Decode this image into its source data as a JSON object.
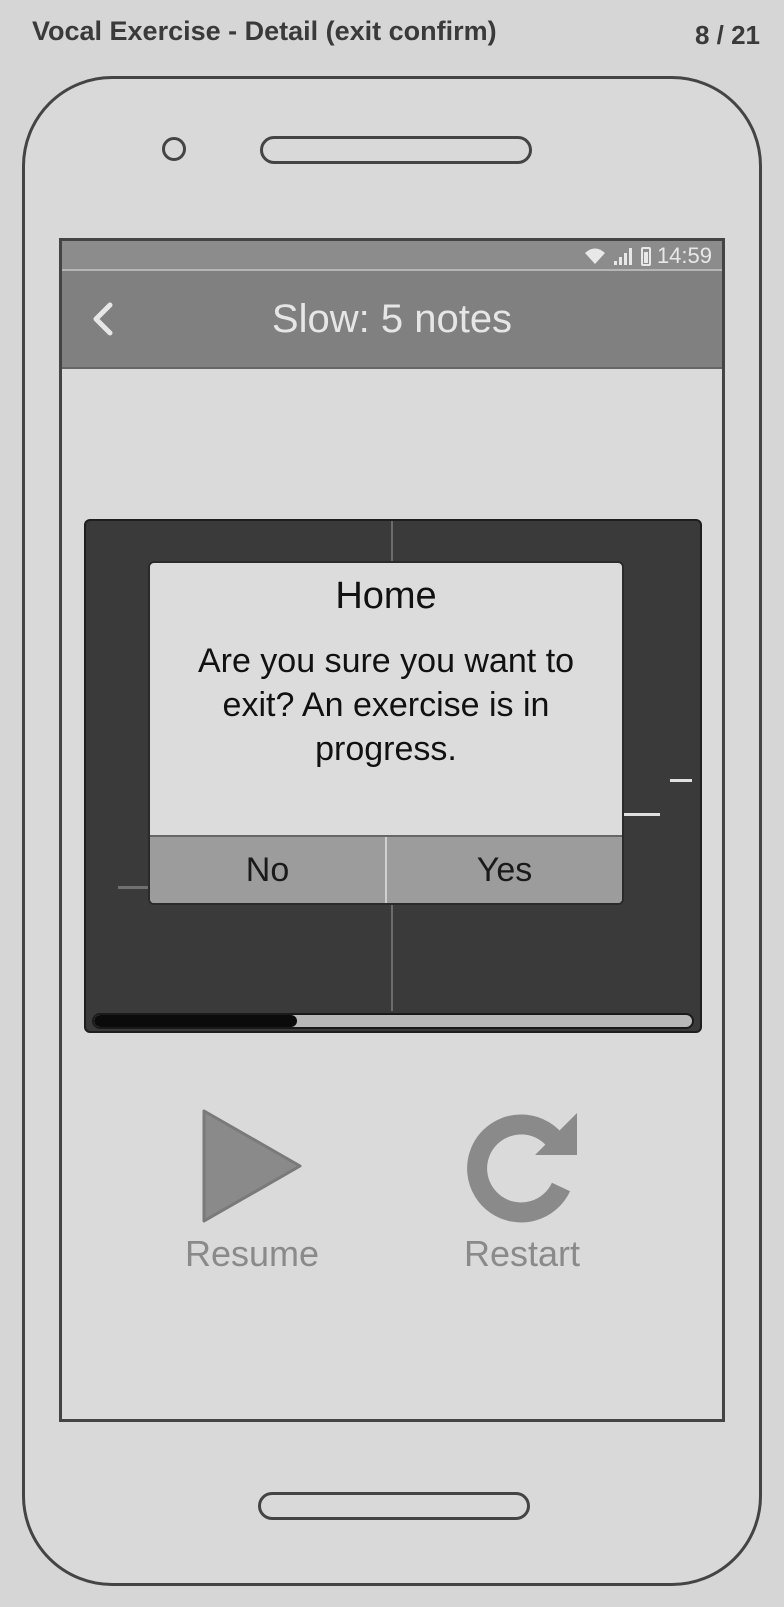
{
  "header": {
    "title": "Vocal Exercise - Detail (exit confirm)",
    "page_count": "8 / 21"
  },
  "statusbar": {
    "time": "14:59",
    "icons": [
      "wifi-icon",
      "signal-icon",
      "battery-icon"
    ]
  },
  "appbar": {
    "back_icon": "chevron-left-icon",
    "title": "Slow: 5 notes"
  },
  "exercise": {
    "progress_percent": 34
  },
  "dialog": {
    "title": "Home",
    "message": "Are you sure you want to exit? An exercise is in progress.",
    "no_label": "No",
    "yes_label": "Yes"
  },
  "controls": {
    "resume_label": "Resume",
    "resume_icon": "play-icon",
    "restart_label": "Restart",
    "restart_icon": "restart-icon"
  },
  "colors": {
    "appbar": "#808080",
    "panel": "#3a3a3a",
    "progress_fill": "#0b0b0b"
  }
}
